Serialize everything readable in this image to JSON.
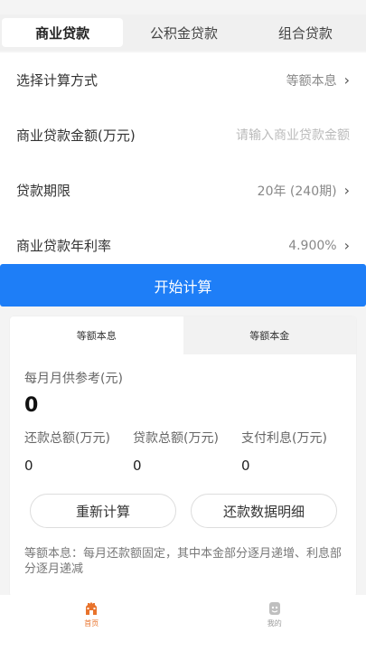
{
  "tabs": [
    {
      "label": "商业贷款",
      "active": true
    },
    {
      "label": "公积金贷款",
      "active": false
    },
    {
      "label": "组合贷款",
      "active": false
    }
  ],
  "form": {
    "method": {
      "label": "选择计算方式",
      "value": "等额本息"
    },
    "amount": {
      "label": "商业贷款金额(万元)",
      "placeholder": "请输入商业贷款金额"
    },
    "term": {
      "label": "贷款期限",
      "value": "20年 (240期)"
    },
    "rate": {
      "label": "商业贷款年利率",
      "value": "4.900%"
    }
  },
  "calculate_label": "开始计算",
  "result": {
    "subtabs": [
      {
        "label": "等额本息",
        "active": true
      },
      {
        "label": "等额本金",
        "active": false
      }
    ],
    "monthly_label": "每月月供参考(元)",
    "monthly_value": "0",
    "stats": [
      {
        "label": "还款总额(万元)",
        "value": "0"
      },
      {
        "label": "贷款总额(万元)",
        "value": "0"
      },
      {
        "label": "支付利息(万元)",
        "value": "0"
      }
    ],
    "recalc_label": "重新计算",
    "detail_label": "还款数据明细",
    "note": "等额本息：每月还款额固定，其中本金部分逐月递增、利息部分逐月递减"
  },
  "bottom_nav": [
    {
      "label": "首页",
      "icon": "home-icon",
      "active": true
    },
    {
      "label": "我的",
      "icon": "profile-icon",
      "active": false
    }
  ],
  "colors": {
    "accent": "#1e7ef7",
    "nav_active": "#e8732c"
  }
}
